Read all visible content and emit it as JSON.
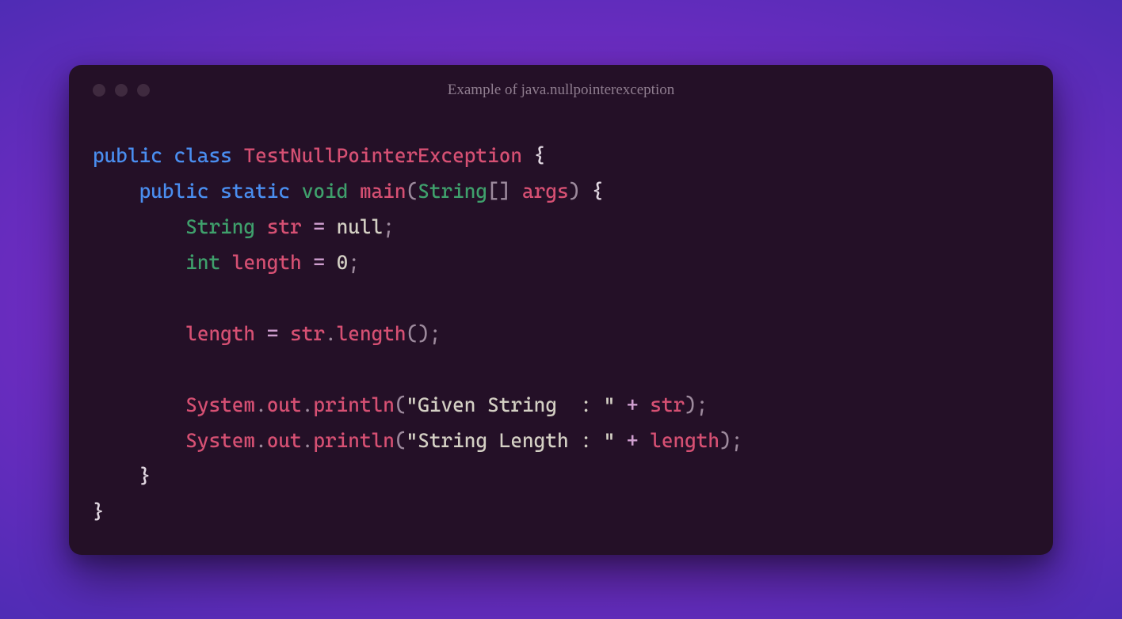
{
  "window": {
    "title": "Example of java.nullpointerexception"
  },
  "code": {
    "tokens": [
      [
        {
          "t": "public",
          "c": "kw"
        },
        {
          "t": " ",
          "c": "pn"
        },
        {
          "t": "class",
          "c": "kw"
        },
        {
          "t": " ",
          "c": "pn"
        },
        {
          "t": "TestNullPointerException",
          "c": "cls"
        },
        {
          "t": " ",
          "c": "pn"
        },
        {
          "t": "{",
          "c": "br"
        }
      ],
      [
        {
          "t": "    ",
          "c": "pn"
        },
        {
          "t": "public",
          "c": "kw"
        },
        {
          "t": " ",
          "c": "pn"
        },
        {
          "t": "static",
          "c": "kw"
        },
        {
          "t": " ",
          "c": "pn"
        },
        {
          "t": "void",
          "c": "type"
        },
        {
          "t": " ",
          "c": "pn"
        },
        {
          "t": "main",
          "c": "fn"
        },
        {
          "t": "(",
          "c": "pn"
        },
        {
          "t": "String",
          "c": "type"
        },
        {
          "t": "[] ",
          "c": "pn"
        },
        {
          "t": "args",
          "c": "args"
        },
        {
          "t": ") ",
          "c": "pn"
        },
        {
          "t": "{",
          "c": "br"
        }
      ],
      [
        {
          "t": "        ",
          "c": "pn"
        },
        {
          "t": "String",
          "c": "type"
        },
        {
          "t": " ",
          "c": "pn"
        },
        {
          "t": "str",
          "c": "id"
        },
        {
          "t": " ",
          "c": "pn"
        },
        {
          "t": "=",
          "c": "op"
        },
        {
          "t": " ",
          "c": "pn"
        },
        {
          "t": "null",
          "c": "null"
        },
        {
          "t": ";",
          "c": "pn"
        }
      ],
      [
        {
          "t": "        ",
          "c": "pn"
        },
        {
          "t": "int",
          "c": "type"
        },
        {
          "t": " ",
          "c": "pn"
        },
        {
          "t": "length",
          "c": "id"
        },
        {
          "t": " ",
          "c": "pn"
        },
        {
          "t": "=",
          "c": "op"
        },
        {
          "t": " ",
          "c": "pn"
        },
        {
          "t": "0",
          "c": "num"
        },
        {
          "t": ";",
          "c": "pn"
        }
      ],
      [],
      [
        {
          "t": "        ",
          "c": "pn"
        },
        {
          "t": "length",
          "c": "id"
        },
        {
          "t": " ",
          "c": "pn"
        },
        {
          "t": "=",
          "c": "op"
        },
        {
          "t": " ",
          "c": "pn"
        },
        {
          "t": "str",
          "c": "id"
        },
        {
          "t": ".",
          "c": "pn"
        },
        {
          "t": "length",
          "c": "fn"
        },
        {
          "t": "();",
          "c": "pn"
        }
      ],
      [],
      [
        {
          "t": "        ",
          "c": "pn"
        },
        {
          "t": "System",
          "c": "cls"
        },
        {
          "t": ".",
          "c": "pn"
        },
        {
          "t": "out",
          "c": "cls"
        },
        {
          "t": ".",
          "c": "pn"
        },
        {
          "t": "println",
          "c": "fn"
        },
        {
          "t": "(",
          "c": "pn"
        },
        {
          "t": "\"Given String  : \"",
          "c": "str"
        },
        {
          "t": " ",
          "c": "pn"
        },
        {
          "t": "+",
          "c": "op"
        },
        {
          "t": " ",
          "c": "pn"
        },
        {
          "t": "str",
          "c": "id"
        },
        {
          "t": ");",
          "c": "pn"
        }
      ],
      [
        {
          "t": "        ",
          "c": "pn"
        },
        {
          "t": "System",
          "c": "cls"
        },
        {
          "t": ".",
          "c": "pn"
        },
        {
          "t": "out",
          "c": "cls"
        },
        {
          "t": ".",
          "c": "pn"
        },
        {
          "t": "println",
          "c": "fn"
        },
        {
          "t": "(",
          "c": "pn"
        },
        {
          "t": "\"String Length : \"",
          "c": "str"
        },
        {
          "t": " ",
          "c": "pn"
        },
        {
          "t": "+",
          "c": "op"
        },
        {
          "t": " ",
          "c": "pn"
        },
        {
          "t": "length",
          "c": "id"
        },
        {
          "t": ");",
          "c": "pn"
        }
      ],
      [
        {
          "t": "    ",
          "c": "pn"
        },
        {
          "t": "}",
          "c": "br"
        }
      ],
      [
        {
          "t": "}",
          "c": "br"
        }
      ]
    ]
  }
}
